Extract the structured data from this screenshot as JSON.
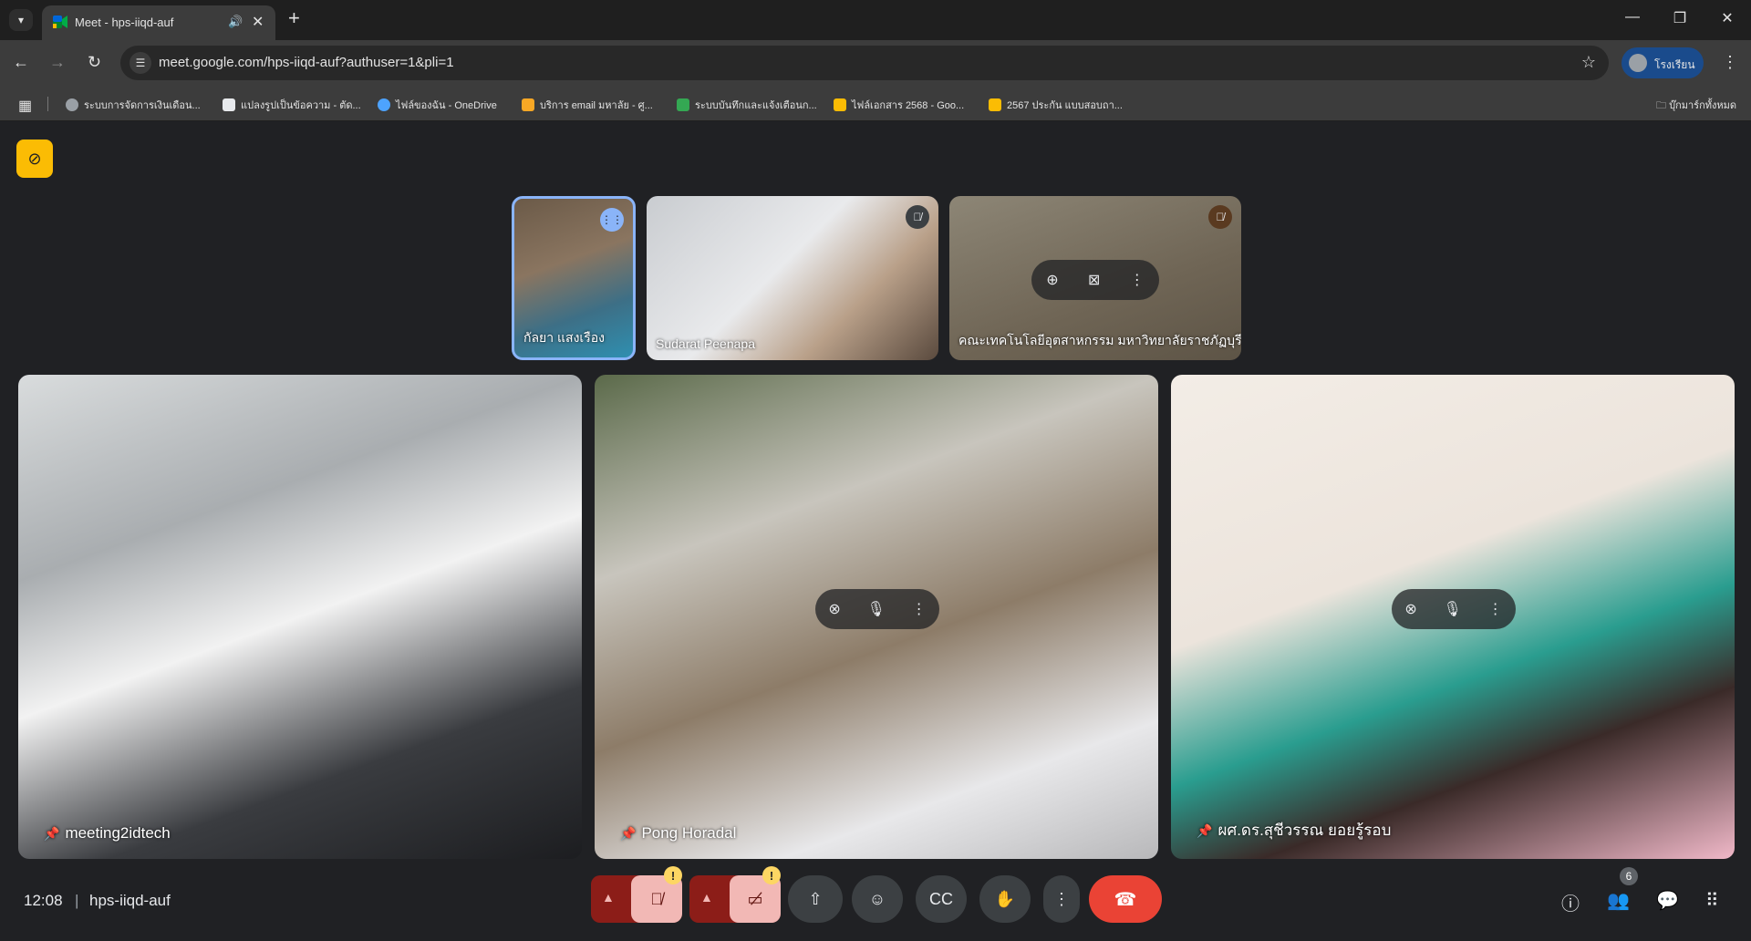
{
  "browser": {
    "tab_title": "Meet - hps-iiqd-auf",
    "url": "meet.google.com/hps-iiqd-auf?authuser=1&pli=1",
    "profile_name": "โรงเรียน",
    "bookmarks": [
      {
        "label": "ระบบการจัดการเงินเดือน...",
        "color": "#9aa0a6"
      },
      {
        "label": "แปลงรูปเป็นข้อความ - ตัด...",
        "color": "#e8eaed"
      },
      {
        "label": "ไฟล์ของฉัน - OneDrive",
        "color": "#4da3ff"
      },
      {
        "label": "บริการ email มหาลัย - ศู...",
        "color": "#f9a825"
      },
      {
        "label": "ระบบบันทึกและแจ้งเตือนก...",
        "color": "#34a853"
      },
      {
        "label": "ไฟล์เอกสาร 2568 - Goo...",
        "color": "#fbbc04"
      },
      {
        "label": "2567 ประกัน แบบสอบถา...",
        "color": "#fbbc04"
      }
    ],
    "all_bookmarks": "บุ๊กมาร์กทั้งหมด"
  },
  "meeting": {
    "time": "12:08",
    "code": "hps-iiqd-auf",
    "participant_count": "6",
    "small_tiles": [
      {
        "name": "กัลยา แสงเรือง",
        "status": "speaking"
      },
      {
        "name": "Sudarat Peenapa",
        "status": "muted"
      },
      {
        "name": "คณะเทคโนโลยีอุตสาหกรรม มหาวิทยาลัยราชภัฏบุรี...",
        "status": "muted"
      }
    ],
    "large_tiles": [
      {
        "name": "meeting2idtech"
      },
      {
        "name": "Pong Horadal"
      },
      {
        "name": "ผศ.ดร.สุชีวรรณ ยอยรู้รอบ"
      }
    ]
  },
  "colors": {
    "background": "#202124",
    "end_call": "#ea4335",
    "muted_control": "#f2b8b5",
    "speaking_border": "#8ab4f8"
  }
}
